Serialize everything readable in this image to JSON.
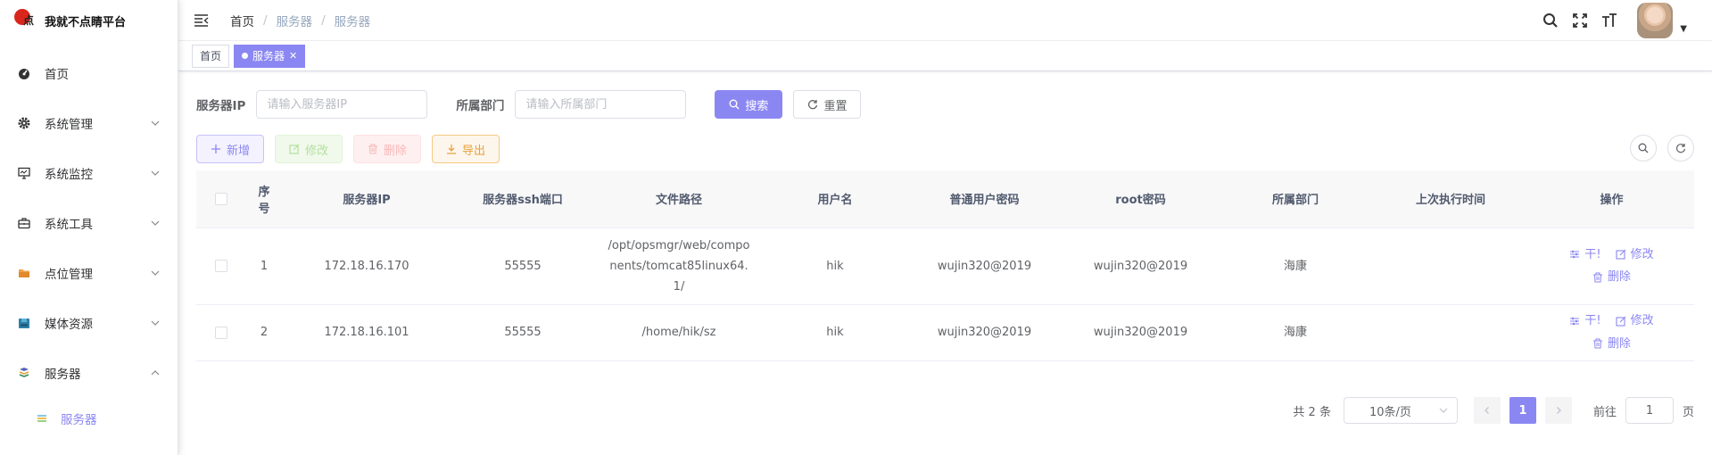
{
  "logo": {
    "title": "我就不点睛平台",
    "mark_text": "不点睛"
  },
  "sidebar": {
    "items": [
      {
        "label": "首页",
        "icon": "dashboard-icon",
        "has_chevron": false
      },
      {
        "label": "系统管理",
        "icon": "gear-icon",
        "has_chevron": true
      },
      {
        "label": "系统监控",
        "icon": "monitor-icon",
        "has_chevron": true
      },
      {
        "label": "系统工具",
        "icon": "toolbox-icon",
        "has_chevron": true
      },
      {
        "label": "点位管理",
        "icon": "folder-icon",
        "has_chevron": true
      },
      {
        "label": "媒体资源",
        "icon": "archive-icon",
        "has_chevron": true
      },
      {
        "label": "服务器",
        "icon": "server-icon",
        "has_chevron": true,
        "expanded": true
      }
    ],
    "submenu": {
      "label": "服务器",
      "icon": "server-stack-icon",
      "active": true
    }
  },
  "navbar": {
    "breadcrumb": [
      "首页",
      "服务器",
      "服务器"
    ]
  },
  "tags": [
    {
      "label": "首页",
      "active": false
    },
    {
      "label": "服务器",
      "active": true
    }
  ],
  "search": {
    "ip_label": "服务器IP",
    "ip_placeholder": "请输入服务器IP",
    "dept_label": "所属部门",
    "dept_placeholder": "请输入所属部门",
    "search_label": "搜索",
    "reset_label": "重置"
  },
  "toolbar": {
    "add_label": "新增",
    "edit_label": "修改",
    "delete_label": "删除",
    "export_label": "导出"
  },
  "table": {
    "headers": [
      "序号",
      "服务器IP",
      "服务器ssh端口",
      "文件路径",
      "用户名",
      "普通用户密码",
      "root密码",
      "所属部门",
      "上次执行时间",
      "操作"
    ],
    "index_header_lines": [
      "序",
      "号"
    ],
    "rows": [
      {
        "index": "1",
        "ip": "172.18.16.170",
        "port": "55555",
        "path_lines": [
          "/opt/opsmgr/web/compo",
          "nents/tomcat85linux64.",
          "1/"
        ],
        "user": "hik",
        "password": "wujin320@2019",
        "root_password": "wujin320@2019",
        "dept": "海康",
        "last_run": ""
      },
      {
        "index": "2",
        "ip": "172.18.16.101",
        "port": "55555",
        "path_lines": [
          "/home/hik/sz"
        ],
        "user": "hik",
        "password": "wujin320@2019",
        "root_password": "wujin320@2019",
        "dept": "海康",
        "last_run": ""
      }
    ],
    "actions": {
      "run": "干!",
      "edit": "修改",
      "delete": "删除"
    }
  },
  "pagination": {
    "total": "共 2 条",
    "page_size": "10条/页",
    "current": "1",
    "goto_prefix": "前往",
    "goto_value": "1",
    "goto_suffix": "页"
  },
  "colors": {
    "primary": "#8b87f2",
    "success": "#b3e19d",
    "danger": "#f9b7b7",
    "warning": "#e6a23c"
  }
}
